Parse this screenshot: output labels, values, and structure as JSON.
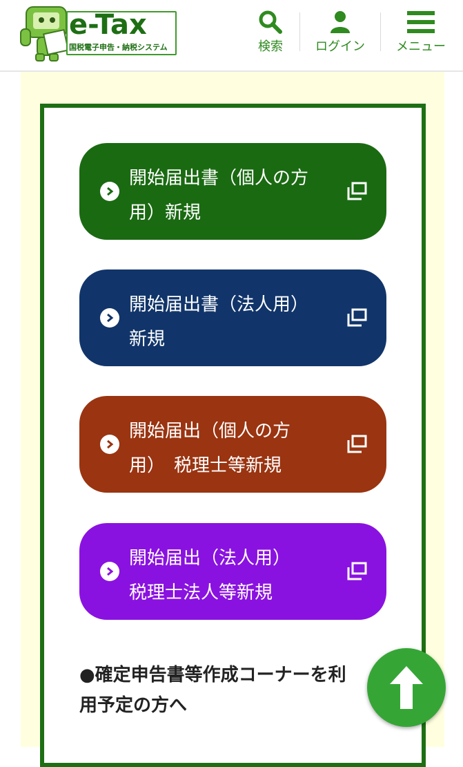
{
  "header": {
    "logo_title": "e-Tax",
    "logo_subtitle": "国税電子申告・納税システム",
    "nav": [
      {
        "label": "検索",
        "icon": "search-icon"
      },
      {
        "label": "ログイン",
        "icon": "user-icon"
      },
      {
        "label": "メニュー",
        "icon": "menu-icon"
      }
    ]
  },
  "buttons": [
    {
      "label": "開始届出書（個人の方\n用）新規",
      "color": "#1a6a12"
    },
    {
      "label": "開始届出書（法人用）\n新規",
      "color": "#11356a"
    },
    {
      "label": "開始届出（個人の方\n用）　税理士等新規",
      "color": "#9a3411"
    },
    {
      "label": "開始届出（法人用）\n税理士法人等新規",
      "color": "#8a12e0"
    }
  ],
  "section_note": {
    "line1": "●確定申告書等作成コーナーを利",
    "line2": "用予定の方へ"
  },
  "colors": {
    "brand_green": "#1e6f14",
    "nav_green": "#2f8a1f",
    "background_yellow": "#ffffe0",
    "fab_green": "#35a635"
  }
}
